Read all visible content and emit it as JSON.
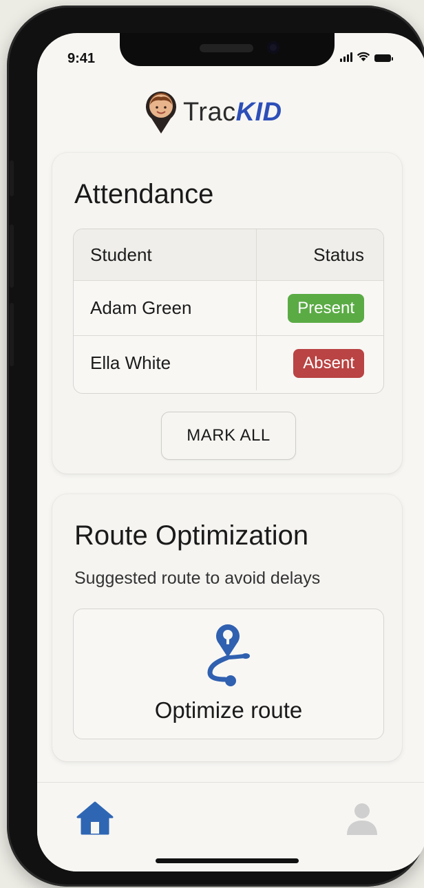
{
  "status_bar": {
    "time": "9:41",
    "icons": [
      "signal-icon",
      "wifi-icon",
      "battery-icon"
    ]
  },
  "header": {
    "logo_prefix": "Trac",
    "logo_suffix": "KID",
    "logo_icon": "child-pin-icon"
  },
  "attendance": {
    "title": "Attendance",
    "columns": [
      "Student",
      "Status"
    ],
    "rows": [
      {
        "name": "Adam Green",
        "status": "Present",
        "status_color": "#5bab45"
      },
      {
        "name": "Ella White",
        "status": "Absent",
        "status_color": "#b94443"
      }
    ],
    "mark_all_label": "MARK ALL"
  },
  "route": {
    "title": "Route Optimization",
    "subtitle": "Suggested route to avoid delays",
    "action_label": "Optimize route",
    "action_icon": "route-icon"
  },
  "bottom_nav": {
    "items": [
      {
        "icon": "home-icon",
        "active": true
      },
      {
        "icon": "profile-icon",
        "active": false
      }
    ]
  },
  "colors": {
    "accent": "#2d4fb8",
    "present": "#5bab45",
    "absent": "#b94443"
  }
}
